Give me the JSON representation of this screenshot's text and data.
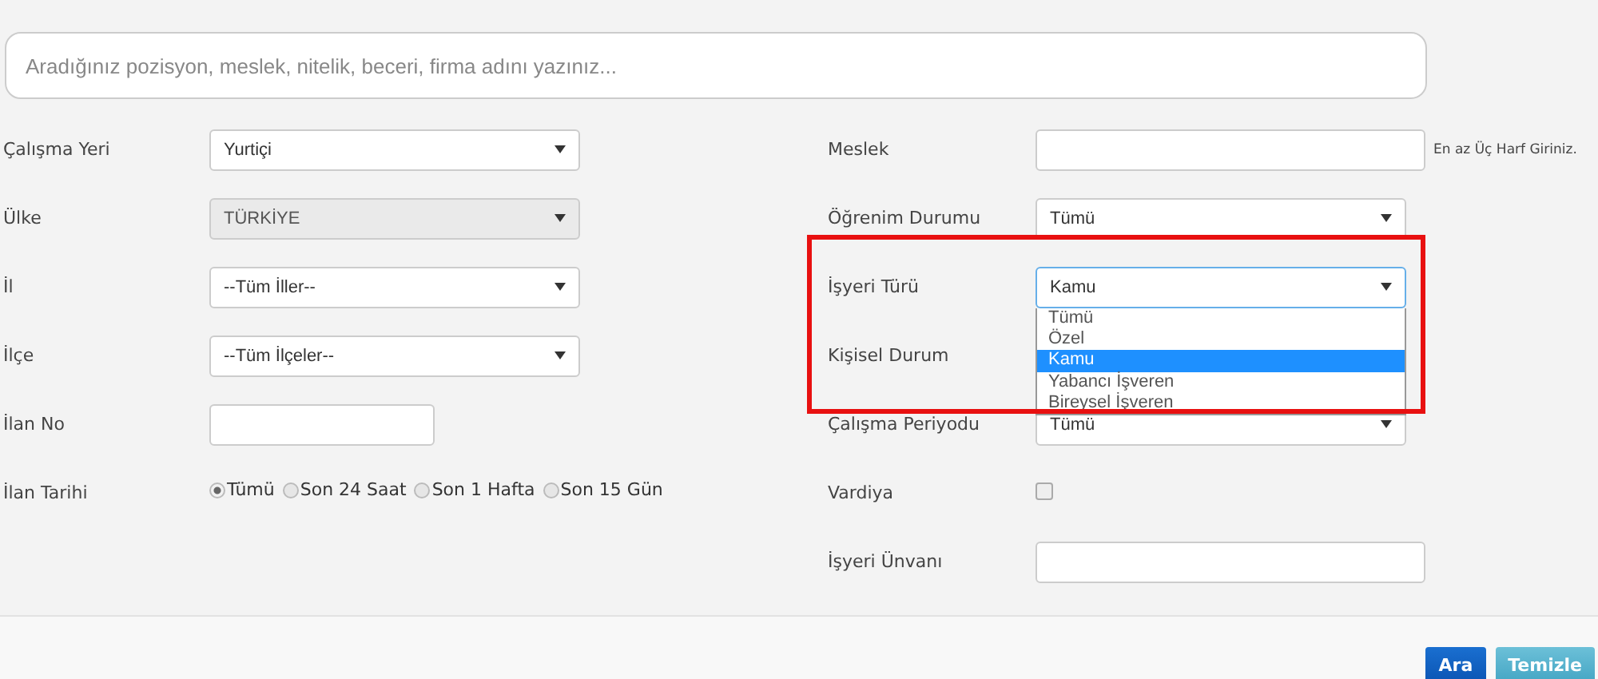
{
  "search": {
    "placeholder": "Aradığınız pozisyon, meslek, nitelik, beceri, firma adını yazınız..."
  },
  "left_fields": [
    {
      "label": "Çalışma Yeri",
      "kind": "select",
      "value": "Yurtiçi",
      "disabled": false
    },
    {
      "label": "Ülke",
      "kind": "select",
      "value": "TÜRKİYE",
      "disabled": true
    },
    {
      "label": "İl",
      "kind": "select",
      "value": "--Tüm İller--",
      "disabled": false
    },
    {
      "label": "İlçe",
      "kind": "select",
      "value": "--Tüm İlçeler--",
      "disabled": false
    },
    {
      "label": "İlan No",
      "kind": "text"
    },
    {
      "label": "İlan Tarihi",
      "kind": "radio",
      "options": [
        {
          "label": "Tümü",
          "selected": true
        },
        {
          "label": "Son 24 Saat",
          "selected": false
        },
        {
          "label": "Son 1 Hafta",
          "selected": false
        },
        {
          "label": "Son 15 Gün",
          "selected": false
        }
      ]
    }
  ],
  "right_fields": [
    {
      "label": "Meslek",
      "kind": "text",
      "hint": "En az Üç Harf Giriniz."
    },
    {
      "label": "Öğrenim Durumu",
      "kind": "select",
      "value": "Tümü",
      "disabled": false
    },
    {
      "label": "İşyeri Türü",
      "kind": "select",
      "value": "Kamu",
      "disabled": false,
      "expanded": true,
      "options": [
        {
          "label": "Tümü",
          "selected": false
        },
        {
          "label": "Özel",
          "selected": false
        },
        {
          "label": "Kamu",
          "selected": true
        },
        {
          "label": "Yabancı İşveren",
          "selected": false
        },
        {
          "label": "Bireysel İşveren",
          "selected": false
        }
      ]
    },
    {
      "label": "Kişisel Durum",
      "kind": "hidden"
    },
    {
      "label": "Çalışma Periyodu",
      "kind": "select",
      "value": "Tümü",
      "disabled": false
    },
    {
      "label": "Vardiya",
      "kind": "checkbox",
      "checked": false
    },
    {
      "label": "İşyeri Ünvanı",
      "kind": "text"
    }
  ],
  "buttons": [
    {
      "label": "Ara",
      "kind": "primary"
    },
    {
      "label": "Temizle",
      "kind": "secondary"
    }
  ]
}
